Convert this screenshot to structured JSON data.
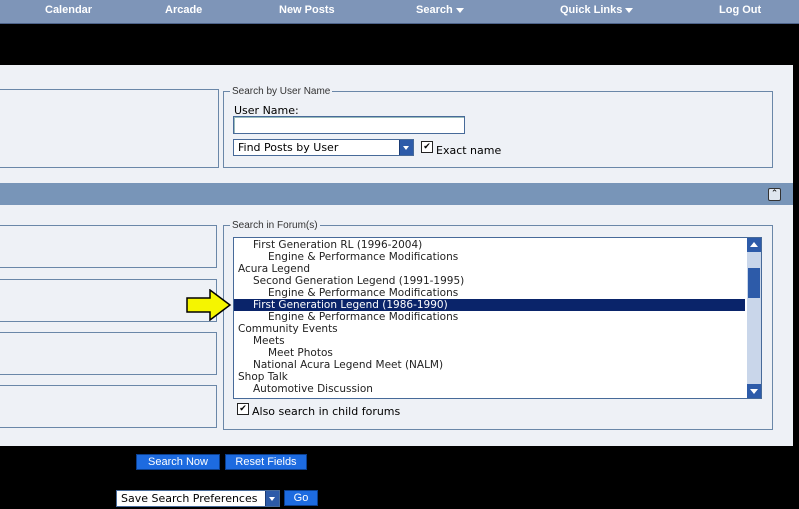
{
  "nav": {
    "calendar": "Calendar",
    "arcade": "Arcade",
    "new_posts": "New Posts",
    "search": "Search",
    "quick_links": "Quick Links",
    "log_out": "Log Out"
  },
  "user_search": {
    "legend": "Search by User Name",
    "label": "User Name:",
    "value": "",
    "mode": "Find Posts by User",
    "exact_label": "Exact name",
    "exact_checked": true
  },
  "forum_search": {
    "legend": "Search in Forum(s)",
    "options": [
      "First Generation RL (1996-2004)",
      "Engine & Performance Modifications",
      "Acura Legend",
      "Second Generation Legend (1991-1995)",
      "Engine & Performance Modifications",
      "First Generation Legend (1986-1990)",
      "Engine & Performance Modifications",
      "Community Events",
      "Meets",
      "Meet Photos",
      "National Acura Legend Meet (NALM)",
      "Shop Talk",
      "Automotive Discussion"
    ],
    "selected_index": 5,
    "child_label": "Also search in child forums",
    "child_checked": true
  },
  "buttons": {
    "search_now": "Search Now",
    "reset": "Reset Fields",
    "prefs": "Save Search Preferences",
    "go": "Go"
  },
  "colors": {
    "accent": "#1d6be0",
    "arrow": "#f5f500",
    "selected": "#0a246a"
  }
}
